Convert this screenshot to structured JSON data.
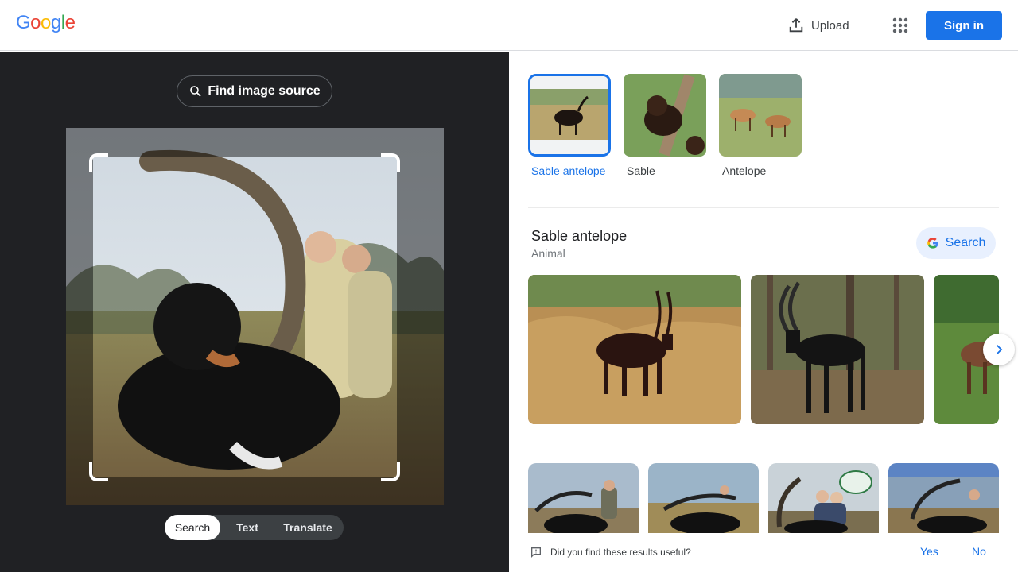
{
  "header": {
    "logo_letters": [
      "G",
      "o",
      "o",
      "g",
      "l",
      "e"
    ],
    "logo_colors": [
      "#4285F4",
      "#EA4335",
      "#FBBC05",
      "#4285F4",
      "#34A853",
      "#EA4335"
    ],
    "upload_label": "Upload",
    "signin_label": "Sign in"
  },
  "lens": {
    "find_source_label": "Find image source",
    "modes": [
      "Search",
      "Text",
      "Translate"
    ],
    "active_mode": "Search"
  },
  "results": {
    "chips": [
      {
        "label": "Sable antelope",
        "selected": true
      },
      {
        "label": "Sable",
        "selected": false
      },
      {
        "label": "Antelope",
        "selected": false
      }
    ],
    "entity": {
      "title": "Sable antelope",
      "subtitle": "Animal",
      "search_label": "Search"
    },
    "feedback": {
      "question": "Did you find these results useful?",
      "yes": "Yes",
      "no": "No"
    }
  },
  "colors": {
    "accent": "#1a73e8",
    "dark_panel": "#202124"
  }
}
